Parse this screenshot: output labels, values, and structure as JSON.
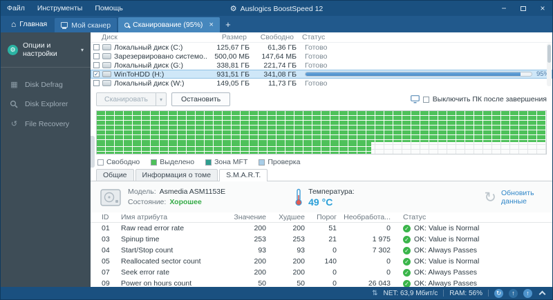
{
  "icons": {
    "gear": "⚙",
    "home": "⌂",
    "close": "×",
    "minimize": "−",
    "add_tab": "+",
    "caret_down": "▾",
    "check": "✓",
    "refresh": "↻",
    "net_arrows": "⇅",
    "arrow_up": "↑",
    "undo": "↺",
    "defrag": "▦"
  },
  "titlebar": {
    "menu": [
      "Файл",
      "Инструменты",
      "Помощь"
    ],
    "title": "Auslogics BoostSpeed 12"
  },
  "tabbar": {
    "home": "Главная",
    "scanner_tab": "Мой сканер",
    "scan_tab": "Сканирование (95%)"
  },
  "sidebar": {
    "options": "Опции и настройки",
    "items": [
      "Disk Defrag",
      "Disk Explorer",
      "File Recovery"
    ]
  },
  "disk_table": {
    "headers": [
      "Диск",
      "Размер",
      "Свободно",
      "Статус"
    ],
    "rows": [
      {
        "name": "Локальный диск (C:)",
        "size": "125,67 ГБ",
        "free": "61,36 ГБ",
        "status": "Готово"
      },
      {
        "name": "Зарезервировано системо...",
        "size": "500,00 МБ",
        "free": "147,64 МБ",
        "status": "Готово"
      },
      {
        "name": "Локальный диск (G:)",
        "size": "338,81 ГБ",
        "free": "221,74 ГБ",
        "status": "Готово"
      },
      {
        "name": "WinToHDD (H:)",
        "size": "931,51 ГБ",
        "free": "341,08 ГБ",
        "status": "95%",
        "progress": 95
      },
      {
        "name": "Локальный диск (W:)",
        "size": "149,05 ГБ",
        "free": "11,73 ГБ",
        "status": "Готово"
      }
    ]
  },
  "controls": {
    "scan": "Сканировать",
    "stop": "Остановить",
    "shutdown": "Выключить ПК после завершения"
  },
  "legend": {
    "items": [
      "Свободно",
      "Выделено",
      "Зона MFT",
      "Проверка"
    ]
  },
  "info_tabs": {
    "items": [
      "Общие",
      "Информация о томе",
      "S.M.A.R.T."
    ]
  },
  "smart": {
    "model_label": "Модель:",
    "model": "Asmedia ASM1153E",
    "state_label": "Состояние:",
    "state": "Хорошее",
    "temp_label": "Температура:",
    "temp": "49 °C",
    "refresh_link": "Обновить данные",
    "headers": [
      "ID",
      "Имя атрибута",
      "Значение",
      "Худшее",
      "Порог",
      "Необработа...",
      "Статус"
    ],
    "rows": [
      [
        "01",
        "Raw read error rate",
        "200",
        "200",
        "51",
        "0",
        "OK: Value is Normal"
      ],
      [
        "03",
        "Spinup time",
        "253",
        "253",
        "21",
        "1 975",
        "OK: Value is Normal"
      ],
      [
        "04",
        "Start/Stop count",
        "93",
        "93",
        "0",
        "7 302",
        "OK: Always Passes"
      ],
      [
        "05",
        "Reallocated sector count",
        "200",
        "200",
        "140",
        "0",
        "OK: Value is Normal"
      ],
      [
        "07",
        "Seek error rate",
        "200",
        "200",
        "0",
        "0",
        "OK: Always Passes"
      ],
      [
        "09",
        "Power on hours count",
        "50",
        "50",
        "0",
        "26 043",
        "OK: Always Passes"
      ]
    ]
  },
  "statusbar": {
    "net": "NET: 63,9 Мбит/с",
    "ram": "RAM: 56%"
  }
}
